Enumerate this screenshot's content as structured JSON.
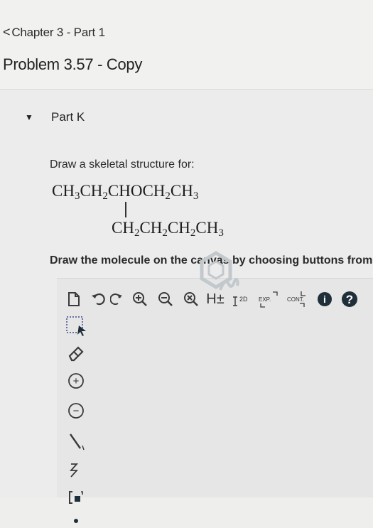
{
  "nav": {
    "back_label": "Chapter 3 - Part 1",
    "chevron": "<"
  },
  "problem": {
    "title": "Problem 3.57 - Copy"
  },
  "part": {
    "toggle_glyph": "▼",
    "title": "Part K"
  },
  "question": {
    "prompt": "Draw a skeletal structure for:",
    "formula_main": [
      "CH",
      "3",
      "CH",
      "2",
      "CHOCH",
      "2",
      "CH",
      "3"
    ],
    "formula_branch": [
      "CH",
      "2",
      "CH",
      "2",
      "CH",
      "2",
      "CH",
      "3"
    ]
  },
  "instructions": "Draw the molecule on the canvas by choosing buttons from",
  "toolbar": {
    "items": [
      {
        "name": "new-document-icon"
      },
      {
        "name": "undo-icon"
      },
      {
        "name": "redo-icon"
      },
      {
        "name": "zoom-in-icon"
      },
      {
        "name": "zoom-out-icon"
      },
      {
        "name": "clear-icon"
      },
      {
        "name": "hydrogen-toggle",
        "label": "H±"
      },
      {
        "name": "2d-clean-icon",
        "label": "2D"
      },
      {
        "name": "expand-icon",
        "label": "EXP."
      },
      {
        "name": "contract-icon",
        "label": "CONT."
      },
      {
        "name": "info-icon",
        "label": "i"
      },
      {
        "name": "help-icon",
        "label": "?"
      }
    ]
  },
  "left_tools": [
    {
      "name": "select-tool-icon"
    },
    {
      "name": "eraser-tool-icon"
    },
    {
      "name": "positive-charge-icon",
      "label": "+"
    },
    {
      "name": "negative-charge-icon",
      "label": "−"
    },
    {
      "name": "single-bond-icon"
    },
    {
      "name": "chain-tool-icon"
    },
    {
      "name": "bracket-tool-icon"
    },
    {
      "name": "dot-tool-icon"
    }
  ],
  "colors": {
    "background": "#ececec",
    "text": "#222222",
    "icon": "#3a3a3a",
    "icon_dark": "#1f2f3a"
  }
}
